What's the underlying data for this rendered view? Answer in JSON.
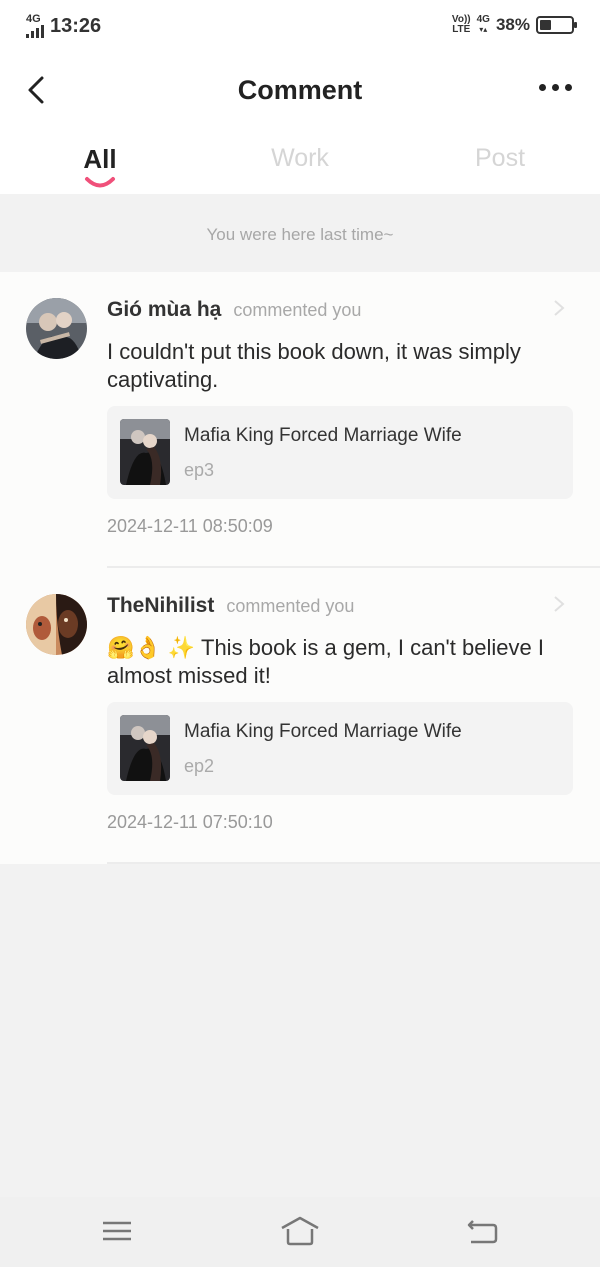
{
  "status_bar": {
    "network": "4G",
    "time": "13:26",
    "volte_top": "Vo))",
    "volte_bottom": "LTE",
    "network_right": "4G",
    "battery_percent": "38%",
    "battery_level": 0.38
  },
  "header": {
    "title": "Comment",
    "back_icon": "chevron-left-icon",
    "more_icon": "more-horizontal-icon"
  },
  "tabs": [
    {
      "label": "All",
      "active": true
    },
    {
      "label": "Work",
      "active": false
    },
    {
      "label": "Post",
      "active": false
    }
  ],
  "notice": "You were here last time~",
  "comments": [
    {
      "username": "Gió mùa hạ",
      "action": "commented you",
      "text": "I couldn't put this book down, it was simply captivating.",
      "book_title": "Mafia King Forced Marriage Wife",
      "episode": "ep3",
      "timestamp": "2024-12-11 08:50:09"
    },
    {
      "username": "TheNihilist",
      "action": "commented you",
      "text": "🤗👌 ✨ This book is a gem, I can't believe I almost missed it!",
      "book_title": "Mafia King Forced Marriage Wife",
      "episode": "ep2",
      "timestamp": "2024-12-11 07:50:10"
    }
  ],
  "colors": {
    "accent": "#f0507a",
    "background": "#f2f2f2",
    "card": "#f3f3f3",
    "muted_text": "#a8a8a8"
  },
  "nav_bar": {
    "menu_icon": "menu-icon",
    "home_icon": "home-icon",
    "back_icon": "back-icon"
  }
}
